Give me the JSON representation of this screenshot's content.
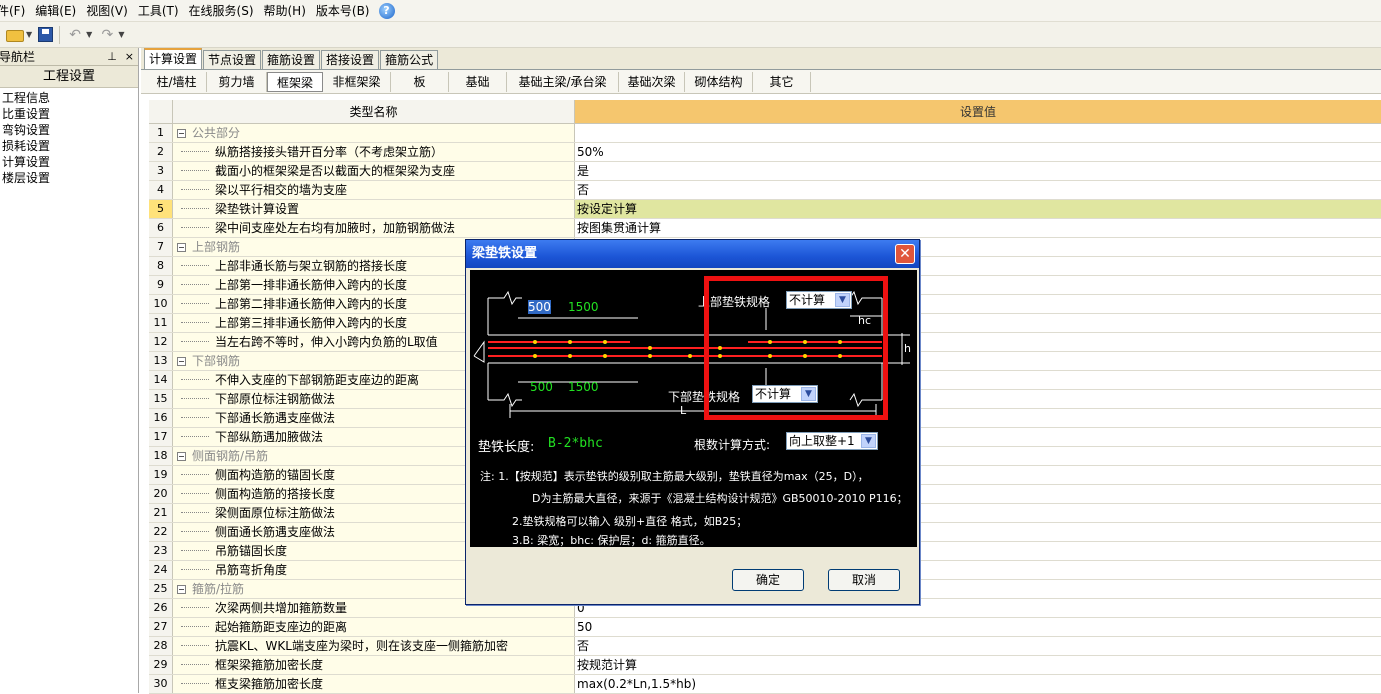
{
  "menu": [
    "件(F)",
    "编辑(E)",
    "视图(V)",
    "工具(T)",
    "在线服务(S)",
    "帮助(H)",
    "版本号(B)"
  ],
  "nav": {
    "title": "导航栏",
    "pin_icon": "pin-icon",
    "close_symbol": "×",
    "section": "工程设置",
    "items": [
      "工程信息",
      "比重设置",
      "弯钩设置",
      "损耗设置",
      "计算设置",
      "楼层设置"
    ]
  },
  "tabs": [
    "计算设置",
    "节点设置",
    "箍筋设置",
    "搭接设置",
    "箍筋公式"
  ],
  "subtabs": [
    "柱/墙柱",
    "剪力墙",
    "框架梁",
    "非框架梁",
    "板",
    "基础",
    "基础主梁/承台梁",
    "基础次梁",
    "砌体结构",
    "其它"
  ],
  "grid": {
    "col_name": "类型名称",
    "col_value": "设置值",
    "rows": [
      {
        "n": "1",
        "name": "公共部分",
        "value": "",
        "group": true
      },
      {
        "n": "2",
        "name": "纵筋搭接接头错开百分率（不考虑架立筋）",
        "value": "50%"
      },
      {
        "n": "3",
        "name": "截面小的框架梁是否以截面大的框架梁为支座",
        "value": "是"
      },
      {
        "n": "4",
        "name": "梁以平行相交的墙为支座",
        "value": "否"
      },
      {
        "n": "5",
        "name": "梁垫铁计算设置",
        "value": "按设定计算",
        "selected": true
      },
      {
        "n": "6",
        "name": "梁中间支座处左右均有加腋时，加筋钢筋做法",
        "value": "按图集贯通计算"
      },
      {
        "n": "7",
        "name": "上部钢筋",
        "value": "",
        "group": true
      },
      {
        "n": "8",
        "name": "上部非通长筋与架立钢筋的搭接长度",
        "value": ""
      },
      {
        "n": "9",
        "name": "上部第一排非通长筋伸入跨内的长度",
        "value": ""
      },
      {
        "n": "10",
        "name": "上部第二排非通长筋伸入跨内的长度",
        "value": ""
      },
      {
        "n": "11",
        "name": "上部第三排非通长筋伸入跨内的长度",
        "value": ""
      },
      {
        "n": "12",
        "name": "当左右跨不等时，伸入小跨内负筋的L取值",
        "value": ""
      },
      {
        "n": "13",
        "name": "下部钢筋",
        "value": "",
        "group": true
      },
      {
        "n": "14",
        "name": "不伸入支座的下部钢筋距支座边的距离",
        "value": ""
      },
      {
        "n": "15",
        "name": "下部原位标注钢筋做法",
        "value": ""
      },
      {
        "n": "16",
        "name": "下部通长筋遇支座做法",
        "value": ""
      },
      {
        "n": "17",
        "name": "下部纵筋遇加腋做法",
        "value": ""
      },
      {
        "n": "18",
        "name": "侧面钢筋/吊筋",
        "value": "",
        "group": true
      },
      {
        "n": "19",
        "name": "侧面构造筋的锚固长度",
        "value": ""
      },
      {
        "n": "20",
        "name": "侧面构造筋的搭接长度",
        "value": ""
      },
      {
        "n": "21",
        "name": "梁侧面原位标注筋做法",
        "value": ""
      },
      {
        "n": "22",
        "name": "侧面通长筋遇支座做法",
        "value": ""
      },
      {
        "n": "23",
        "name": "吊筋锚固长度",
        "value": ""
      },
      {
        "n": "24",
        "name": "吊筋弯折角度",
        "value": ""
      },
      {
        "n": "25",
        "name": "箍筋/拉筋",
        "value": "",
        "group": true
      },
      {
        "n": "26",
        "name": "次梁两侧共增加箍筋数量",
        "value": "0"
      },
      {
        "n": "27",
        "name": "起始箍筋距支座边的距离",
        "value": "50"
      },
      {
        "n": "28",
        "name": "抗震KL、WKL端支座为梁时，则在该支座一侧箍筋加密",
        "value": "否"
      },
      {
        "n": "29",
        "name": "框架梁箍筋加密长度",
        "value": "按规范计算"
      },
      {
        "n": "30",
        "name": "框支梁箍筋加密长度",
        "value": "max(0.2*Ln,1.5*hb)"
      }
    ]
  },
  "dialog": {
    "title": "梁垫铁设置",
    "close_symbol": "✕",
    "upper_label": "上部垫铁规格",
    "upper_value": "不计算",
    "lower_label": "下部垫铁规格",
    "lower_value": "不计算",
    "dim_500_top": "500",
    "dim_1500_top": "1500",
    "dim_500_bot": "500",
    "dim_1500_bot": "1500",
    "dim_hc": "hc",
    "dim_L": "L",
    "dim_h": "h",
    "length_label": "垫铁长度:",
    "length_value": "B-2*bhc",
    "count_label": "根数计算方式:",
    "count_value": "向上取整+1",
    "note1": "注: 1.【按规范】表示垫铁的级别取主筋最大级别，垫铁直径为max（25，D），",
    "note2": "D为主筋最大直径，来源于《混凝土结构设计规范》GB50010-2010 P116；",
    "note3": "2.垫铁规格可以输入 级别+直径 格式，如B25；",
    "note4": "3.B: 梁宽；bhc: 保护层；d: 箍筋直径。",
    "ok": "确定",
    "cancel": "取消",
    "highlight_color": "#ee1111",
    "rebar_color": "#ff2020",
    "dot_color": "#ffd000"
  }
}
